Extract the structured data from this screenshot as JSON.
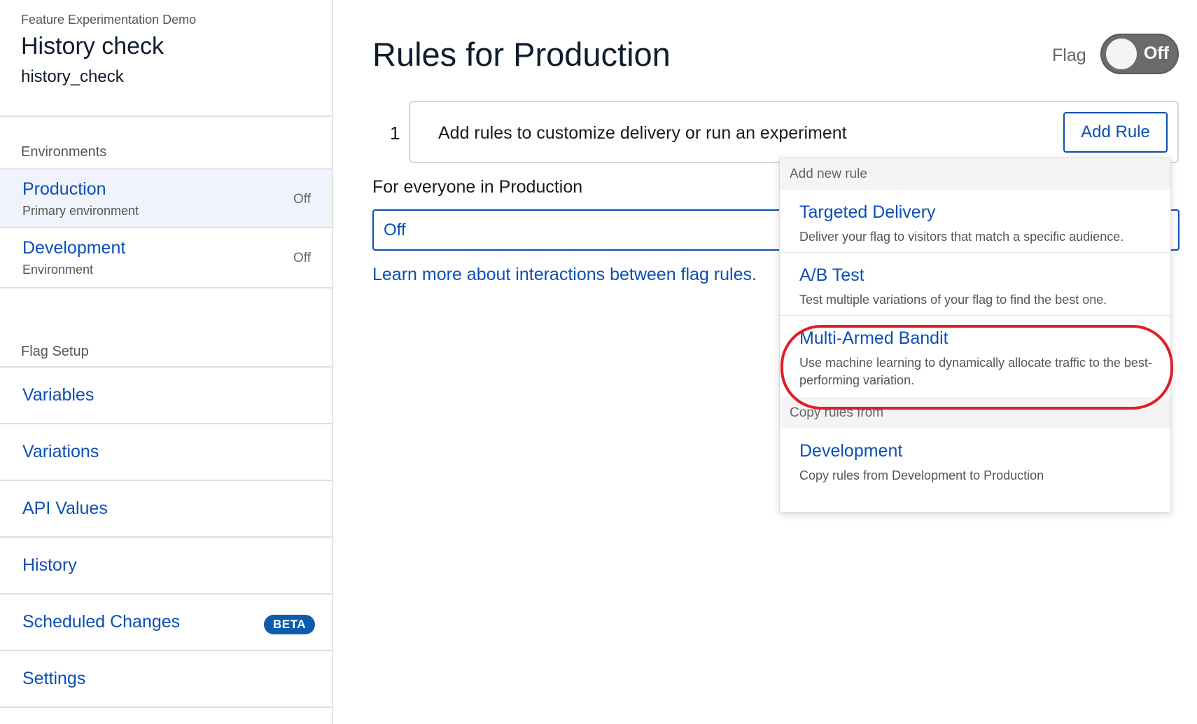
{
  "sidebar": {
    "project_name": "Feature Experimentation Demo",
    "flag_name": "History check",
    "flag_key": "history_check",
    "environments_label": "Environments",
    "environments": [
      {
        "name": "Production",
        "subtitle": "Primary environment",
        "status": "Off"
      },
      {
        "name": "Development",
        "subtitle": "Environment",
        "status": "Off"
      }
    ],
    "flag_setup_label": "Flag Setup",
    "setup_items": [
      {
        "label": "Variables"
      },
      {
        "label": "Variations"
      },
      {
        "label": "API Values"
      },
      {
        "label": "History"
      },
      {
        "label": "Scheduled Changes",
        "badge": "BETA"
      },
      {
        "label": "Settings"
      }
    ]
  },
  "main": {
    "title": "Rules for Production",
    "flag_label": "Flag",
    "flag_toggle": "Off",
    "rule_number": "1",
    "rule_prompt": "Add rules to customize delivery or run an experiment",
    "add_rule_label": "Add Rule",
    "everyone_label": "For everyone in Production",
    "default_value": "Off",
    "learn_more": "Learn more about interactions between flag rules."
  },
  "dropdown": {
    "add_new_rule_label": "Add new rule",
    "rules": [
      {
        "title": "Targeted Delivery",
        "description": "Deliver your flag to visitors that match a specific audience."
      },
      {
        "title": "A/B Test",
        "description": "Test multiple variations of your flag to find the best one."
      },
      {
        "title": "Multi-Armed Bandit",
        "description": "Use machine learning to dynamically allocate traffic to the best-performing variation."
      }
    ],
    "copy_rules_label": "Copy rules from",
    "copy_sources": [
      {
        "title": "Development",
        "description": "Copy rules from Development to Production"
      }
    ]
  },
  "colors": {
    "link_blue": "#0b4fb5",
    "badge_blue": "#0b5cad",
    "highlight_red": "#e01e26",
    "toggle_gray": "#6b6b6b"
  }
}
